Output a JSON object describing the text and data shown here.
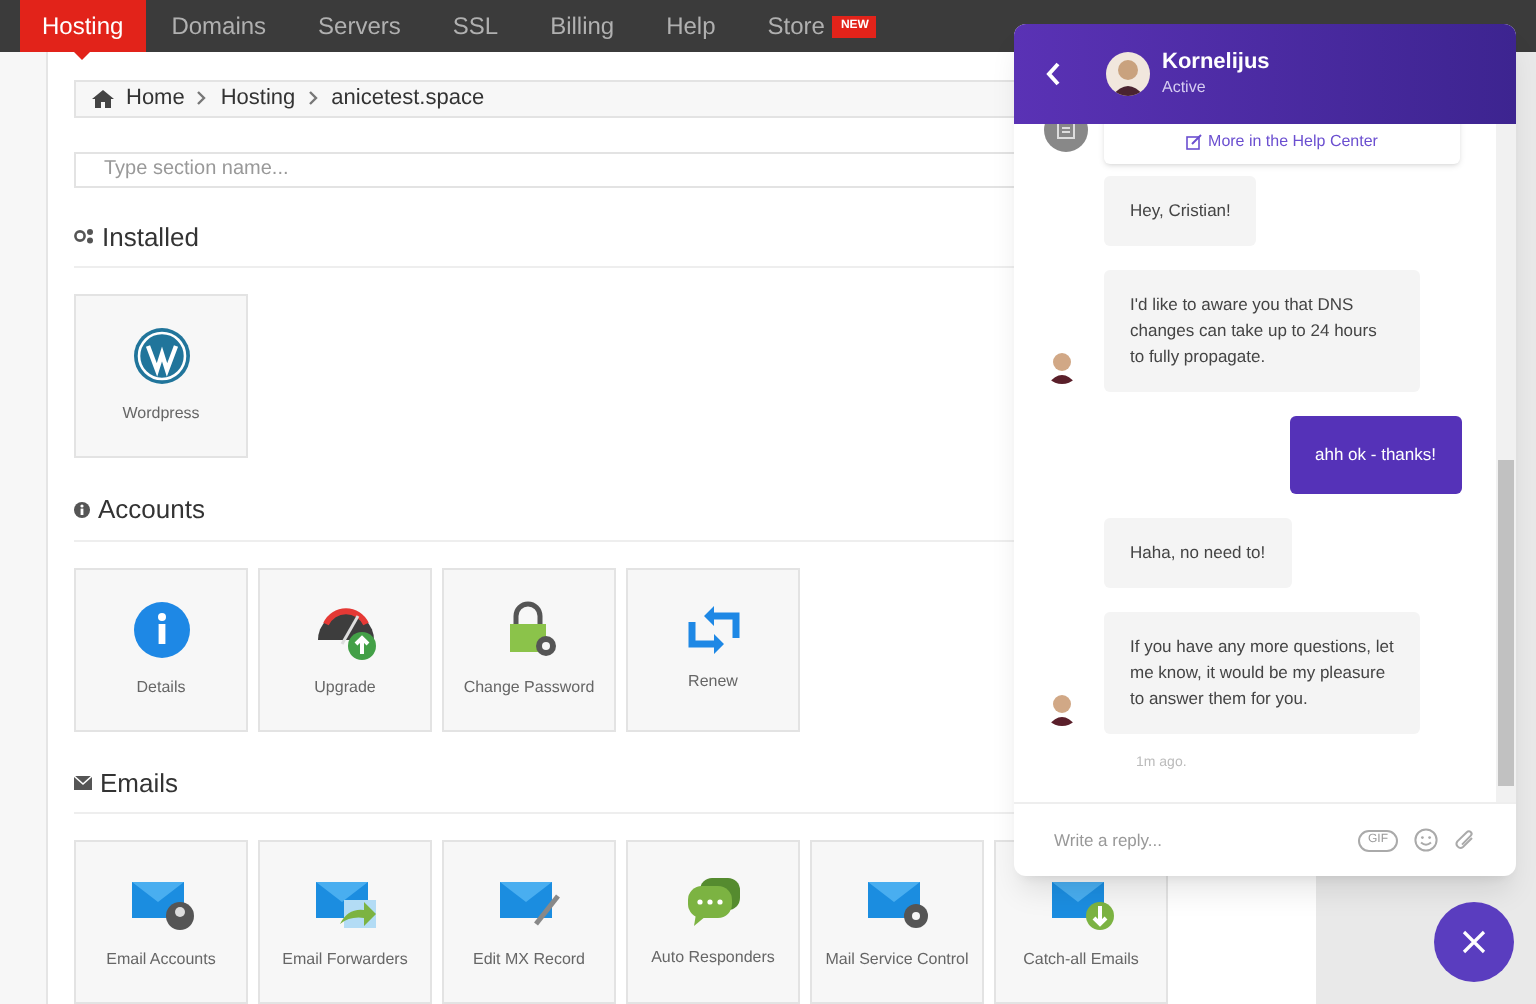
{
  "nav": {
    "items": [
      {
        "label": "Hosting",
        "selected": true
      },
      {
        "label": "Domains",
        "selected": false
      },
      {
        "label": "Servers",
        "selected": false
      },
      {
        "label": "SSL",
        "selected": false
      },
      {
        "label": "Billing",
        "selected": false
      },
      {
        "label": "Help",
        "selected": false
      },
      {
        "label": "Store",
        "selected": false,
        "badge": "NEW"
      }
    ]
  },
  "breadcrumb": [
    "Home",
    "Hosting",
    "anicetest.space"
  ],
  "search": {
    "placeholder": "Type section name..."
  },
  "sections": [
    {
      "title": "Installed",
      "tiles": [
        {
          "label": "Wordpress"
        }
      ]
    },
    {
      "title": "Accounts",
      "tiles": [
        {
          "label": "Details"
        },
        {
          "label": "Upgrade"
        },
        {
          "label": "Change Password"
        },
        {
          "label": "Renew"
        }
      ]
    },
    {
      "title": "Emails",
      "tiles": [
        {
          "label": "Email Accounts"
        },
        {
          "label": "Email Forwarders"
        },
        {
          "label": "Edit MX Record"
        },
        {
          "label": "Auto Responders"
        },
        {
          "label": "Mail Service Control"
        },
        {
          "label": "Catch-all Emails"
        }
      ]
    }
  ],
  "chat": {
    "agent": {
      "name": "Kornelijus",
      "status": "Active"
    },
    "help_link": "More in the Help Center",
    "messages": [
      {
        "kind": "agent",
        "text": "Hey, Cristian!",
        "avatar": false
      },
      {
        "kind": "agent",
        "text": "I'd like to aware you that DNS changes can take up to 24 hours to fully propagate.",
        "avatar": true
      },
      {
        "kind": "user",
        "text": "ahh ok - thanks!"
      },
      {
        "kind": "agent",
        "text": "Haha, no need to!",
        "avatar": false
      },
      {
        "kind": "agent",
        "text": "If you have any more questions, let me know, it would be my pleasure to answer them for you.",
        "avatar": true
      }
    ],
    "timestamp": "1m ago.",
    "reply": {
      "placeholder": "Write a reply..."
    },
    "gif": "GIF"
  }
}
